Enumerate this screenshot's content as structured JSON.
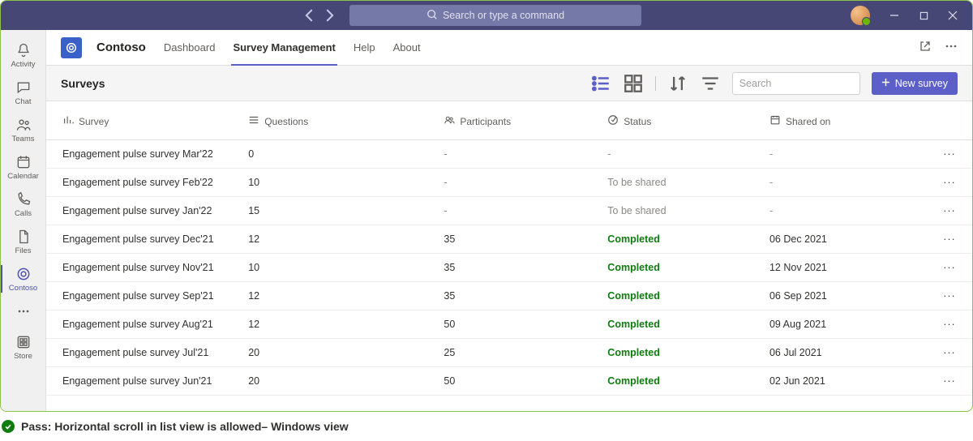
{
  "titlebar": {
    "search_placeholder": "Search or type a command"
  },
  "apprail": {
    "items": [
      {
        "id": "activity",
        "label": "Activity"
      },
      {
        "id": "chat",
        "label": "Chat"
      },
      {
        "id": "teams",
        "label": "Teams"
      },
      {
        "id": "calendar",
        "label": "Calendar"
      },
      {
        "id": "calls",
        "label": "Calls"
      },
      {
        "id": "files",
        "label": "Files"
      },
      {
        "id": "contoso",
        "label": "Contoso"
      },
      {
        "id": "more",
        "label": ""
      },
      {
        "id": "store",
        "label": "Store"
      }
    ]
  },
  "app_header": {
    "app_name": "Contoso",
    "tabs": [
      {
        "label": "Dashboard"
      },
      {
        "label": "Survey Management"
      },
      {
        "label": "Help"
      },
      {
        "label": "About"
      }
    ]
  },
  "command_bar": {
    "page_title": "Surveys",
    "search_placeholder": "Search",
    "new_survey_label": "New survey"
  },
  "table": {
    "columns": {
      "survey": "Survey",
      "questions": "Questions",
      "participants": "Participants",
      "status": "Status",
      "shared_on": "Shared on"
    },
    "rows": [
      {
        "survey": "Engagement pulse survey Mar'22",
        "questions": "0",
        "participants": "-",
        "status": "-",
        "shared_on": "-"
      },
      {
        "survey": "Engagement pulse survey Feb'22",
        "questions": "10",
        "participants": "-",
        "status": "To be shared",
        "shared_on": "-"
      },
      {
        "survey": "Engagement pulse survey Jan'22",
        "questions": "15",
        "participants": "-",
        "status": "To be shared",
        "shared_on": "-"
      },
      {
        "survey": "Engagement pulse survey Dec'21",
        "questions": "12",
        "participants": "35",
        "status": "Completed",
        "shared_on": "06 Dec 2021"
      },
      {
        "survey": "Engagement pulse survey Nov'21",
        "questions": "10",
        "participants": "35",
        "status": "Completed",
        "shared_on": "12 Nov 2021"
      },
      {
        "survey": "Engagement pulse survey Sep'21",
        "questions": "12",
        "participants": "35",
        "status": "Completed",
        "shared_on": "06 Sep 2021"
      },
      {
        "survey": "Engagement pulse survey Aug'21",
        "questions": "12",
        "participants": "50",
        "status": "Completed",
        "shared_on": "09 Aug 2021"
      },
      {
        "survey": "Engagement pulse survey Jul'21",
        "questions": "20",
        "participants": "25",
        "status": "Completed",
        "shared_on": "06 Jul 2021"
      },
      {
        "survey": "Engagement pulse survey Jun'21",
        "questions": "20",
        "participants": "50",
        "status": "Completed",
        "shared_on": "02 Jun 2021"
      }
    ]
  },
  "caption": {
    "text": "Pass: Horizontal scroll in list view is allowed– Windows view"
  }
}
